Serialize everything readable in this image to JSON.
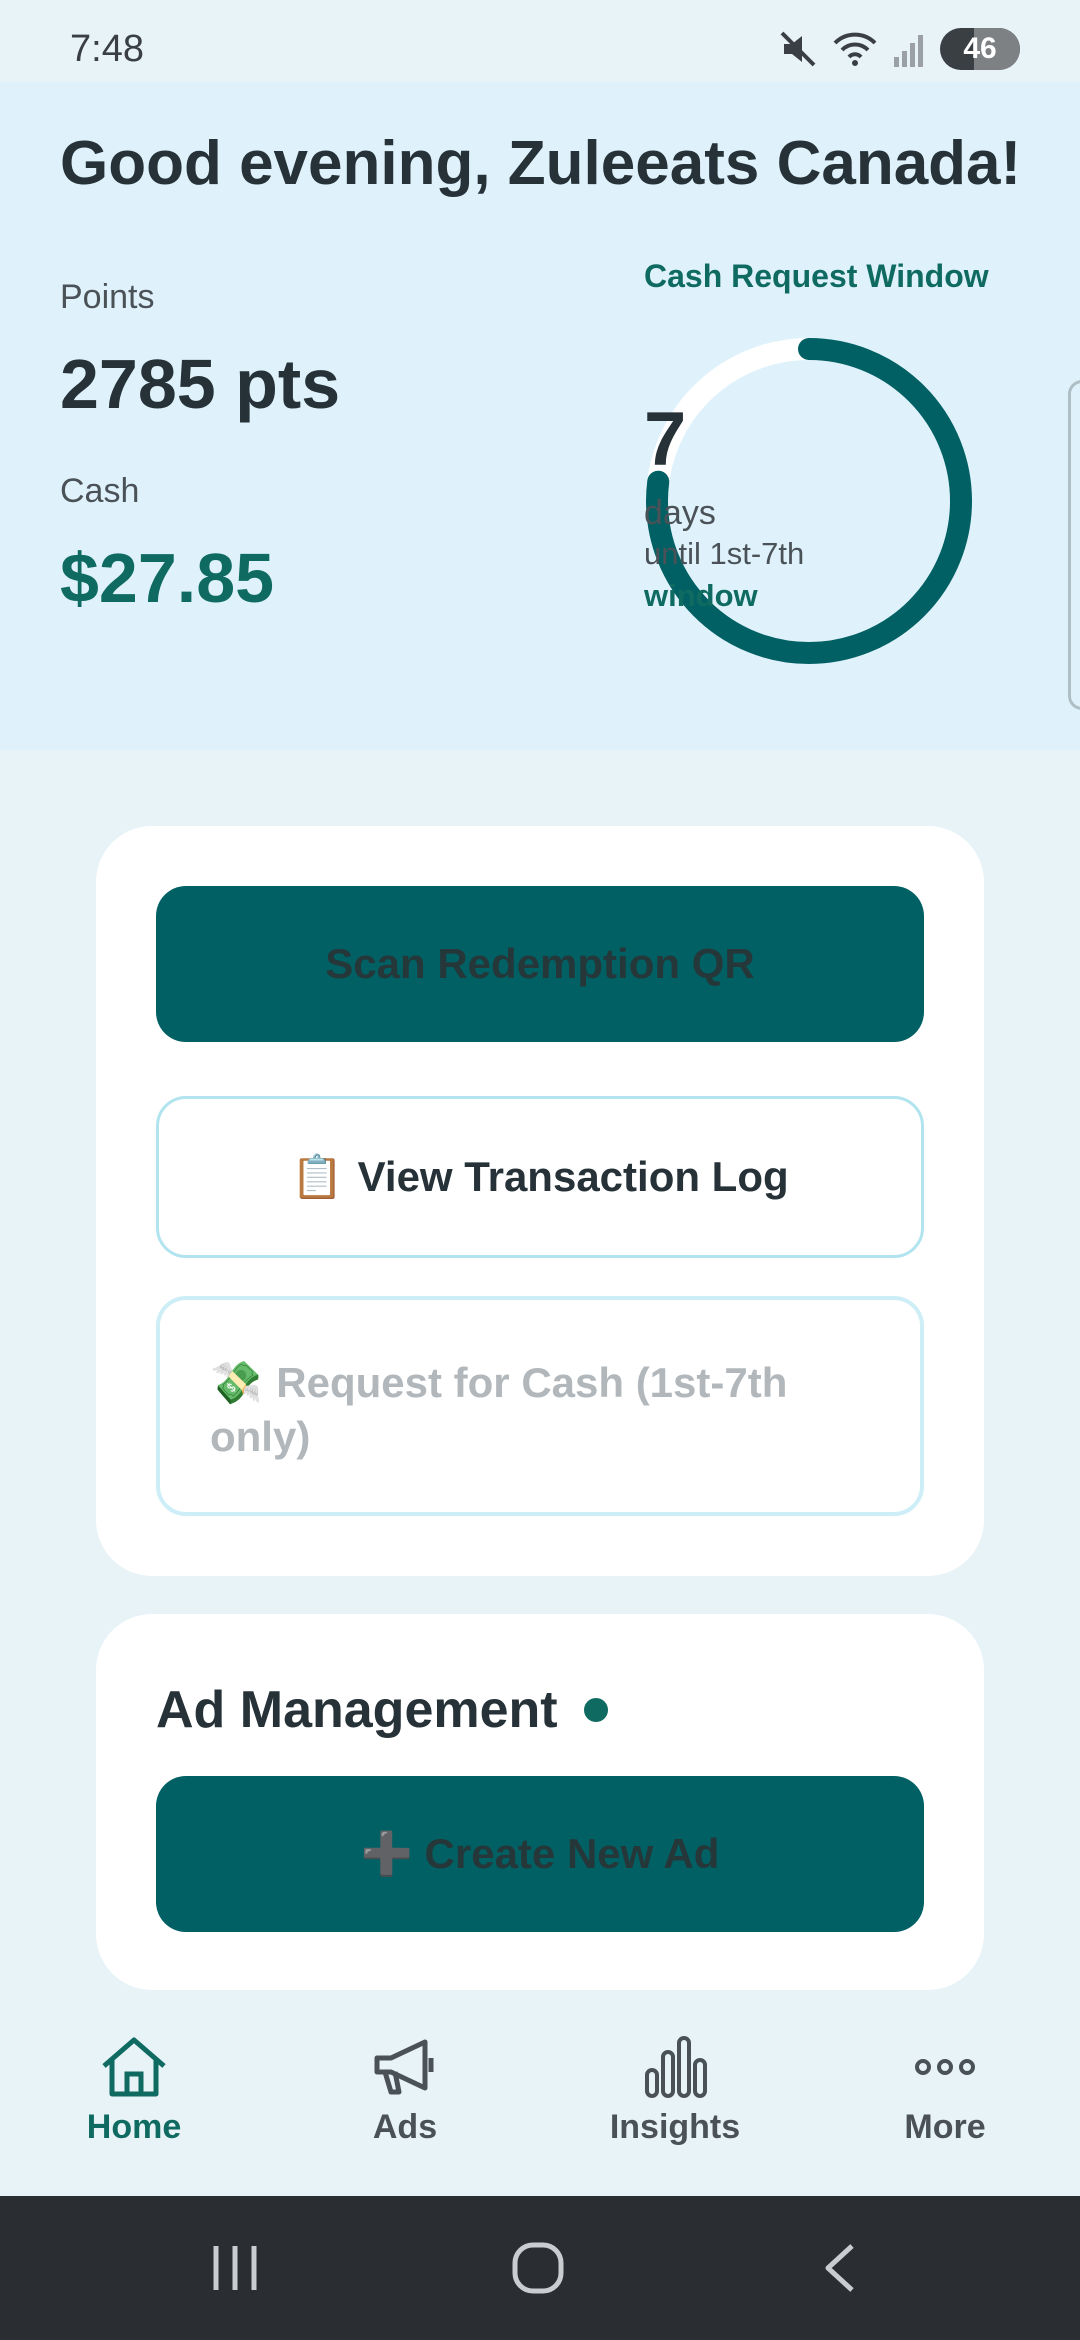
{
  "status_bar": {
    "time": "7:48",
    "battery": "46"
  },
  "header": {
    "greeting": "Good evening, Zuleeats Canada!",
    "points_label": "Points",
    "points_value": "2785 pts",
    "cash_label": "Cash",
    "cash_value": "$27.85",
    "window_title": "Cash Request Window",
    "countdown": {
      "number": "7",
      "unit": "days",
      "until": "until 1st-7th",
      "window": "window",
      "progress_fraction": 0.77
    }
  },
  "actions": {
    "scan_label": "Scan Redemption QR",
    "log_emoji": "📋",
    "log_label": "View Transaction Log",
    "cash_emoji": "💸",
    "cash_label": "Request for Cash (1st-7th only)"
  },
  "ads": {
    "title": "Ad Management",
    "create_label": "➕ Create New Ad"
  },
  "bottom_nav": {
    "items": [
      {
        "label": "Home",
        "icon": "home-icon",
        "active": true
      },
      {
        "label": "Ads",
        "icon": "megaphone-icon",
        "active": false
      },
      {
        "label": "Insights",
        "icon": "bar-chart-icon",
        "active": false
      },
      {
        "label": "More",
        "icon": "more-dots-icon",
        "active": false
      }
    ]
  },
  "colors": {
    "accent": "#0f6b61",
    "primary_button": "#016064",
    "background": "#e8f3f8",
    "header_bg": "#dff2fb"
  }
}
